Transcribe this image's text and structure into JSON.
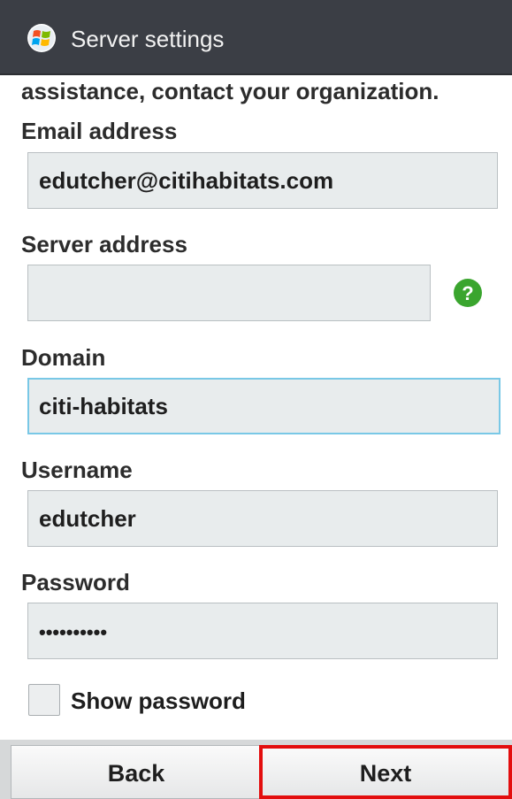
{
  "titlebar": {
    "title": "Server settings",
    "icon": "windows-logo-icon"
  },
  "intro_text": "assistance, contact your organization.",
  "fields": {
    "email": {
      "label": "Email address",
      "value": "edutcher@citihabitats.com"
    },
    "server": {
      "label": "Server address",
      "value": "",
      "help_icon": "help-question-icon"
    },
    "domain": {
      "label": "Domain",
      "value": "citi-habitats"
    },
    "username": {
      "label": "Username",
      "value": "edutcher"
    },
    "password": {
      "label": "Password",
      "value": "••••••••••"
    }
  },
  "show_password": {
    "label": "Show password",
    "checked": false
  },
  "buttons": {
    "back": "Back",
    "next": "Next"
  },
  "colors": {
    "titlebar": "#3b3e45",
    "field_bg": "#e8eced",
    "focus_border": "#79c8e6",
    "help_green": "#3aa52e",
    "highlight_red": "#e30e0e"
  }
}
